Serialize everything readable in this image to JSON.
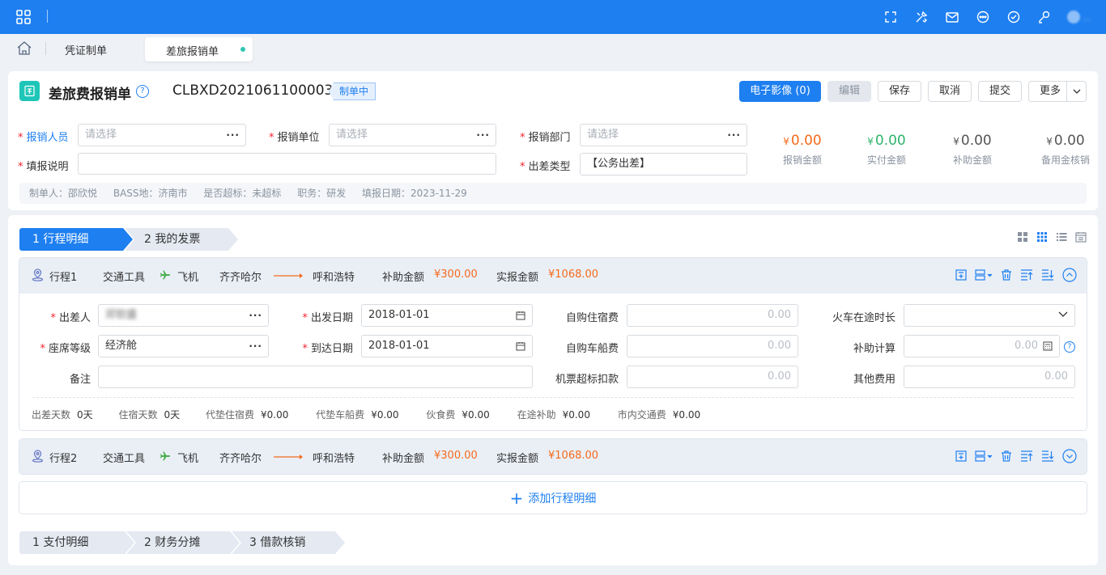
{
  "topbar": {
    "icons": [
      "grid-icon",
      "fullscreen-icon",
      "tools-icon",
      "mail-icon",
      "chat-icon",
      "check-circle-icon",
      "user-key-icon"
    ],
    "user_name": "...",
    "accent": "#1e7ff0"
  },
  "tabs": [
    {
      "label": "凭证制单"
    },
    {
      "label": "差旅报销单",
      "active": true
    }
  ],
  "header": {
    "title": "差旅费报销单",
    "doc_no": "CLBXD2021061100003",
    "status": "制单中",
    "buttons": {
      "image": "电子影像 (0)",
      "edit": "编辑",
      "save": "保存",
      "cancel": "取消",
      "submit": "提交",
      "more": "更多"
    }
  },
  "form": {
    "claimant": {
      "label": "报销人员",
      "placeholder": "请选择"
    },
    "unit": {
      "label": "报销单位",
      "placeholder": "请选择"
    },
    "dept": {
      "label": "报销部门",
      "placeholder": "请选择"
    },
    "remark": {
      "label": "填报说明",
      "value": ""
    },
    "trip_type": {
      "label": "出差类型",
      "value": "【公务出差】"
    }
  },
  "amounts": [
    {
      "label": "报销金额",
      "value": "0.00",
      "color": "#f56a1b"
    },
    {
      "label": "实付金额",
      "value": "0.00",
      "color": "#2fb36b"
    },
    {
      "label": "补助金额",
      "value": "0.00",
      "color": "#555555"
    },
    {
      "label": "备用金核销",
      "value": "0.00",
      "color": "#555555"
    }
  ],
  "currency": "¥",
  "meta": {
    "maker": "制单人：邵欣悦",
    "bass": "BASS地：济南市",
    "over": "是否超标：未超标",
    "job": "职务：研发",
    "date": "填报日期：2023-11-29"
  },
  "steps_top": [
    {
      "label": "1 行程明细"
    },
    {
      "label": "2 我的发票"
    }
  ],
  "trips": [
    {
      "name": "行程1",
      "vehicle_label": "交通工具",
      "vehicle": "飞机",
      "from": "齐齐哈尔",
      "to": "呼和浩特",
      "subsidy_label": "补助金额",
      "subsidy": "¥300.00",
      "actual_label": "实报金额",
      "actual": "¥1068.00"
    },
    {
      "name": "行程2",
      "vehicle_label": "交通工具",
      "vehicle": "飞机",
      "from": "齐齐哈尔",
      "to": "呼和浩特",
      "subsidy_label": "补助金额",
      "subsidy": "¥300.00",
      "actual_label": "实报金额",
      "actual": "¥1068.00"
    }
  ],
  "trip_form": {
    "traveler": {
      "label": "出差人",
      "value": "邓钦盛"
    },
    "depart": {
      "label": "出发日期",
      "value": "2018-01-01"
    },
    "hotel": {
      "label": "自购住宿费",
      "value": "0.00"
    },
    "train": {
      "label": "火车在途时长",
      "value": ""
    },
    "seat": {
      "label": "座席等级",
      "value": "经济舱"
    },
    "arrive": {
      "label": "到达日期",
      "value": "2018-01-01"
    },
    "ticket": {
      "label": "自购车船费",
      "value": "0.00"
    },
    "subsidy_calc": {
      "label": "补助计算",
      "value": "0.00"
    },
    "note": {
      "label": "备注",
      "value": ""
    },
    "over_deduct": {
      "label": "机票超标扣款",
      "value": "0.00"
    },
    "other": {
      "label": "其他费用",
      "value": "0.00"
    }
  },
  "summary": [
    {
      "label": "出差天数",
      "value": "0天"
    },
    {
      "label": "住宿天数",
      "value": "0天"
    },
    {
      "label": "代垫住宿费",
      "value": "¥0.00"
    },
    {
      "label": "代垫车船费",
      "value": "¥0.00"
    },
    {
      "label": "伙食费",
      "value": "¥0.00"
    },
    {
      "label": "在途补助",
      "value": "¥0.00"
    },
    {
      "label": "市内交通费",
      "value": "¥0.00"
    }
  ],
  "add_trip": "添加行程明细",
  "steps_bottom": [
    {
      "label": "1 支付明细"
    },
    {
      "label": "2 财务分摊"
    },
    {
      "label": "3 借款核销"
    }
  ]
}
